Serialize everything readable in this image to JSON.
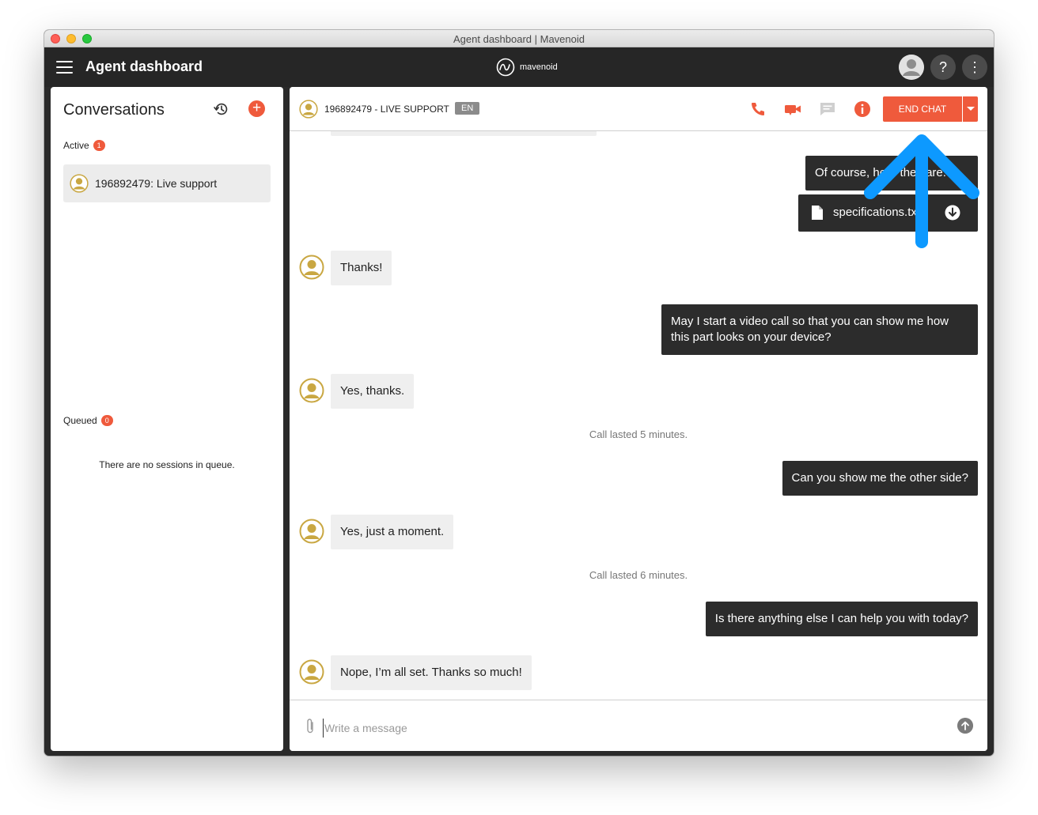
{
  "window": {
    "title": "Agent dashboard | Mavenoid"
  },
  "appbar": {
    "title": "Agent dashboard",
    "brand": "mavenoid",
    "help_label": "?",
    "more_label": "⋮"
  },
  "conversations": {
    "title": "Conversations",
    "add_label": "+",
    "active": {
      "label": "Active",
      "count": "1"
    },
    "items": [
      {
        "label": "196892479: Live support"
      }
    ],
    "queued": {
      "label": "Queued",
      "count": "0",
      "empty_text": "There are no sessions in queue."
    }
  },
  "chat": {
    "id_label": "196892479 - LIVE SUPPORT",
    "language": "EN",
    "end_chat_label": "END CHAT",
    "colors": {
      "accent": "#ef5a3c",
      "agent_bubble": "#2c2c2c",
      "customer_bubble": "#efefef",
      "annotation_arrow": "#0d99ff"
    },
    "messages": [
      {
        "from": "agent",
        "text": "Of course, here they are:"
      },
      {
        "from": "agent",
        "type": "file",
        "text": "specifications.txt"
      },
      {
        "from": "customer",
        "text": "Thanks!"
      },
      {
        "from": "agent",
        "text": "May I start a video call so that you can show me how this part looks on your device?"
      },
      {
        "from": "customer",
        "text": "Yes, thanks."
      },
      {
        "from": "system",
        "text": "Call lasted 5 minutes."
      },
      {
        "from": "agent",
        "text": "Can you show me the other side?"
      },
      {
        "from": "customer",
        "text": "Yes, just a moment."
      },
      {
        "from": "system",
        "text": "Call lasted 6 minutes."
      },
      {
        "from": "agent",
        "text": "Is there anything else I can help you with today?"
      },
      {
        "from": "customer",
        "text": "Nope, I’m all set. Thanks so much!"
      }
    ],
    "composer": {
      "placeholder": "Write a message"
    }
  }
}
